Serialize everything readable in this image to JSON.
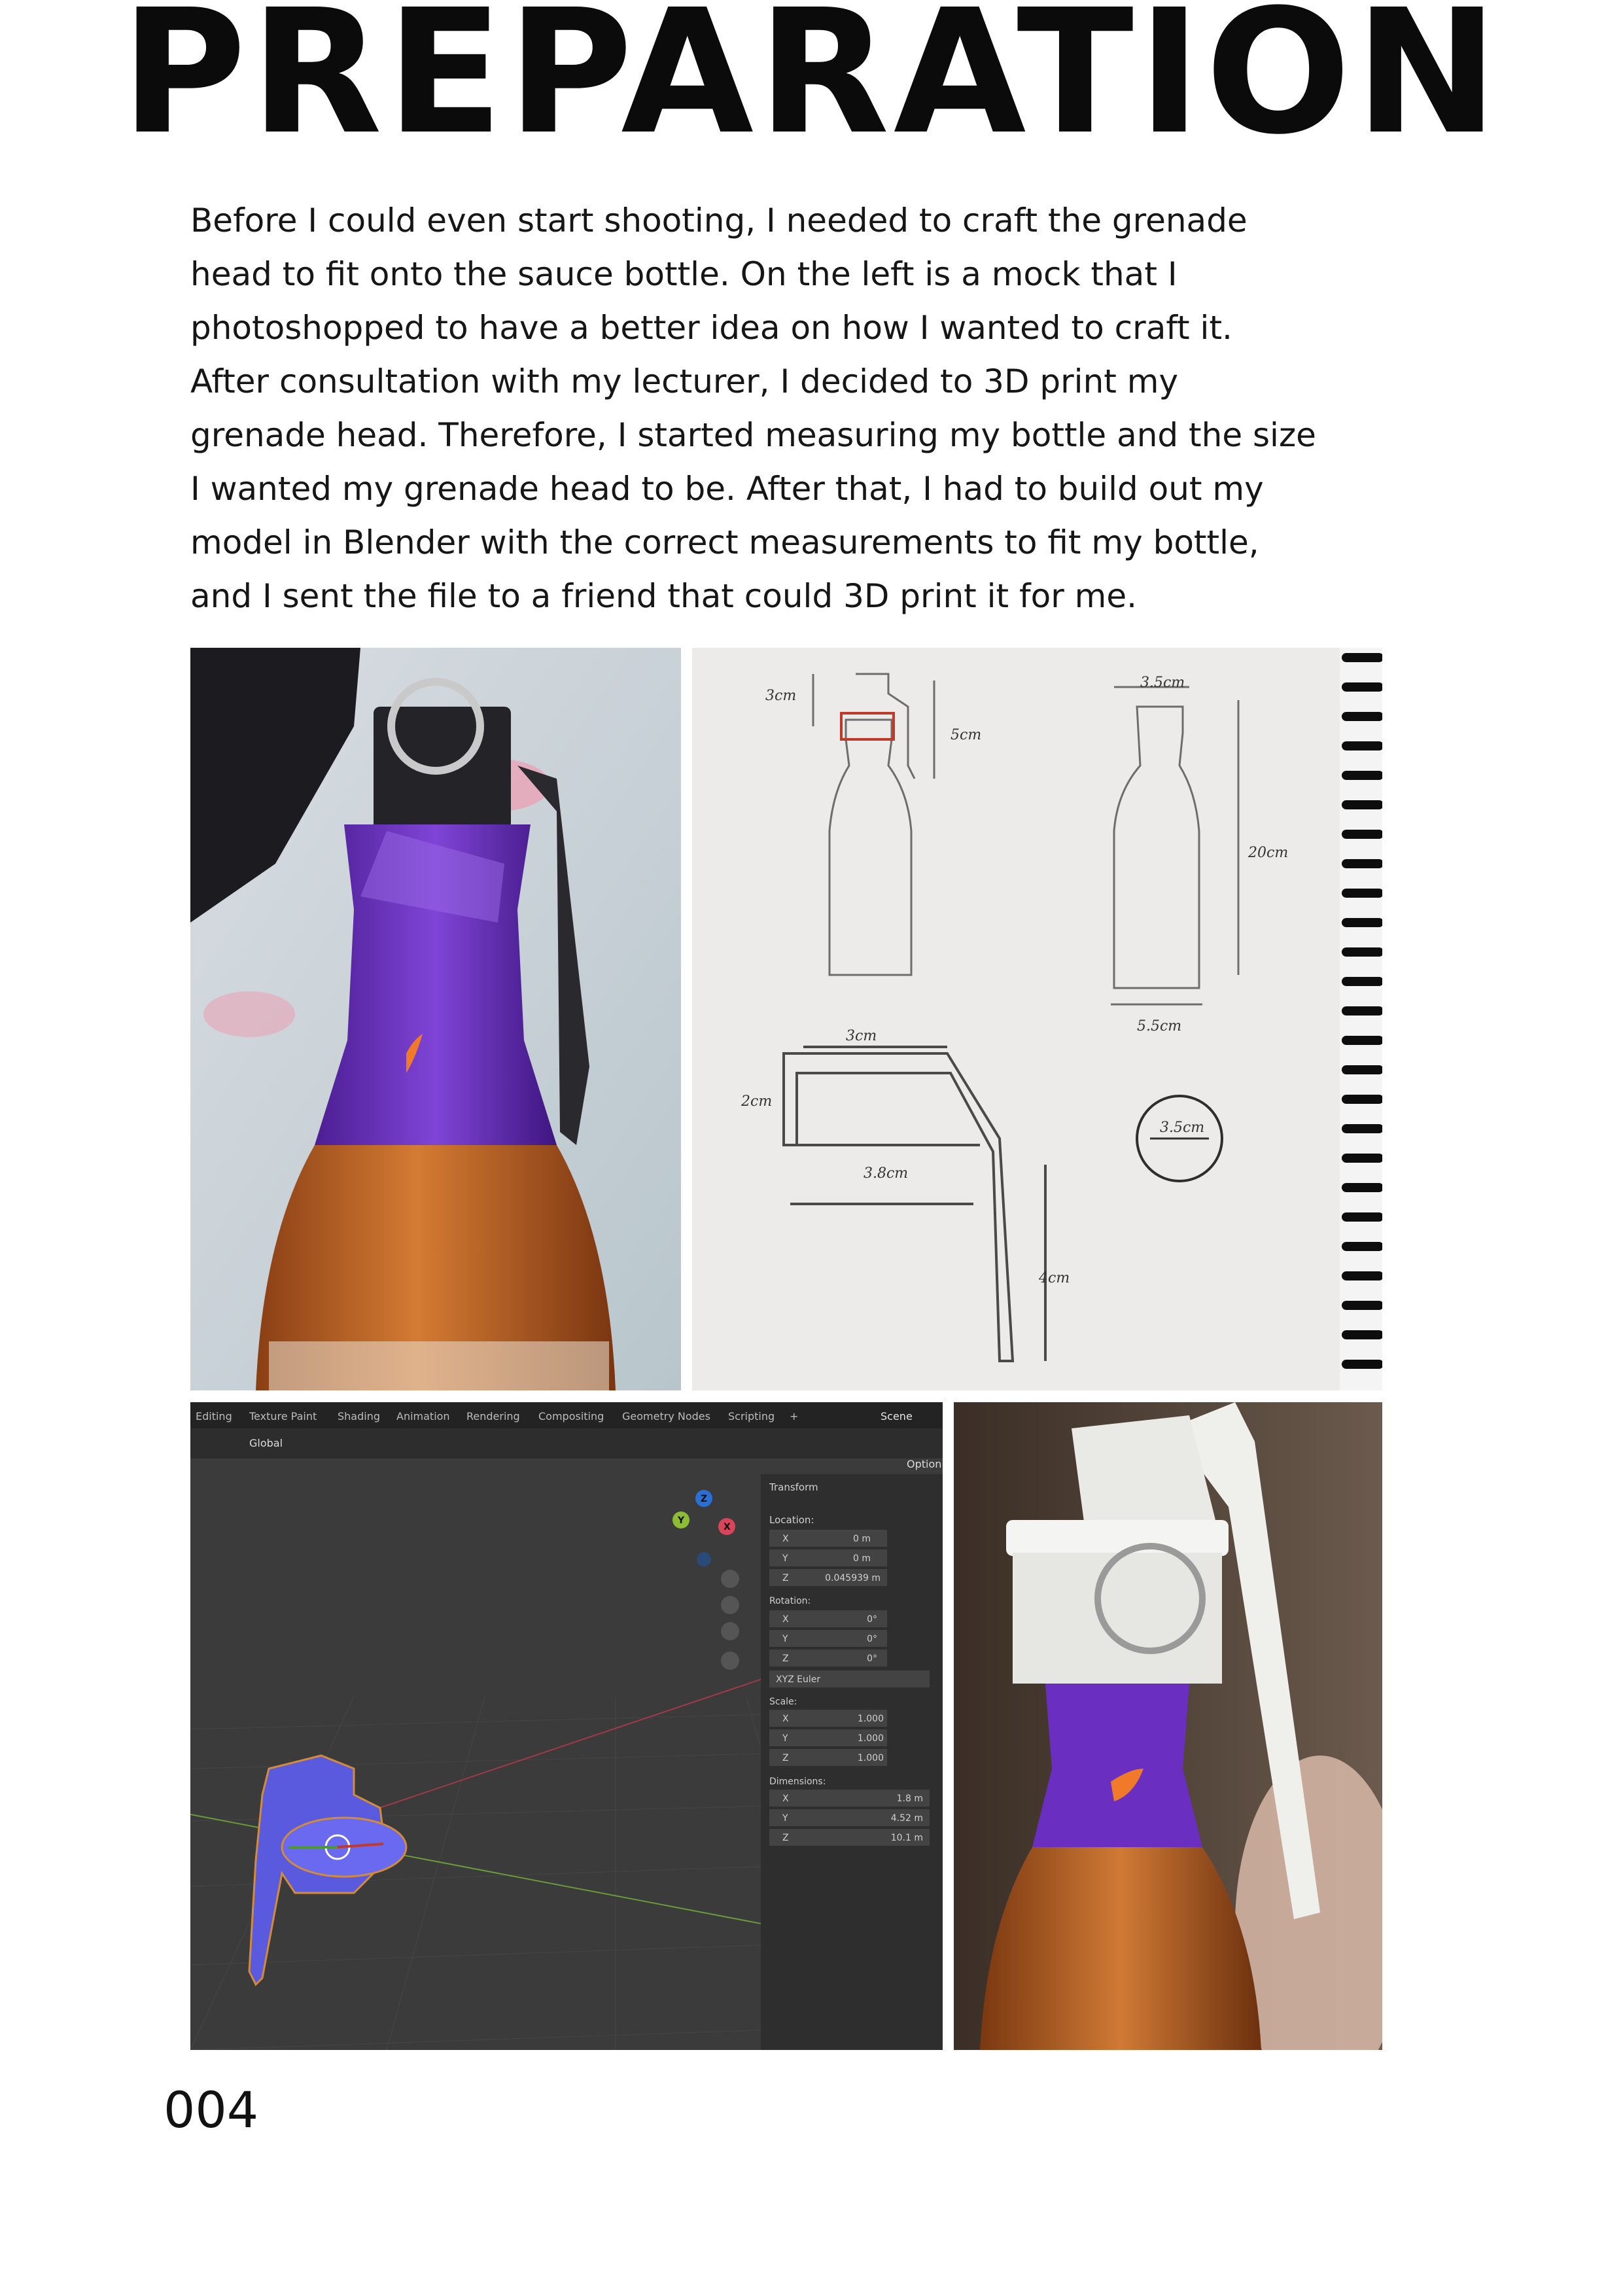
{
  "page": {
    "title": "PREPARATION",
    "body": "Before I could even start shooting, I needed to craft the grenade\nhead to fit onto the sauce bottle. On the left is a mock that I\nphotoshopped to have a better idea on how I wanted to craft it.\nAfter consultation with my lecturer, I decided to 3D print my\ngrenade head. Therefore, I started measuring my bottle and the size\nI wanted my grenade head to be. After that, I had to build out my\nmodel in Blender with the correct measurements to fit my bottle,\nand I sent the file to a friend that could 3D print it for me.",
    "page_number": "004"
  },
  "sketch": {
    "label_3cm_top": "3cm",
    "label_5cm": "5cm",
    "label_35cm": "3.5cm",
    "label_20cm": "20cm",
    "label_55cm": "5.5cm",
    "label_3cm": "3cm",
    "label_2cm": "2cm",
    "label_38cm": "3.8cm",
    "label_35cm_circle": "3.5cm",
    "label_4cm": "4cm"
  },
  "blender": {
    "tabs": [
      "Editing",
      "Texture Paint",
      "Shading",
      "Animation",
      "Rendering",
      "Compositing",
      "Geometry Nodes",
      "Scripting",
      "+"
    ],
    "scene_label": "Scene",
    "global_label": "Global",
    "options_label": "Option",
    "panel_title": "Transform",
    "location_label": "Location:",
    "loc_x": "0 m",
    "loc_y": "0 m",
    "loc_z": "0.045939 m",
    "rotation_label": "Rotation:",
    "rot_x": "0°",
    "rot_y": "0°",
    "rot_z": "0°",
    "rotation_mode": "XYZ Euler",
    "scale_label": "Scale:",
    "scale_x": "1.000",
    "scale_y": "1.000",
    "scale_z": "1.000",
    "dimensions_label": "Dimensions:",
    "dim_x": "1.8 m",
    "dim_y": "4.52 m",
    "dim_z": "10.1 m",
    "axis_x": "X",
    "axis_y": "Y",
    "axis_z": "Z"
  },
  "colors": {
    "purple_wrap": "#6a2fc0",
    "sauce": "#c7702c",
    "blender_bg": "#3a3a3a",
    "blender_model": "#5a5adf",
    "paper": "#ecebe9",
    "white_cap": "#f2f2f0"
  }
}
